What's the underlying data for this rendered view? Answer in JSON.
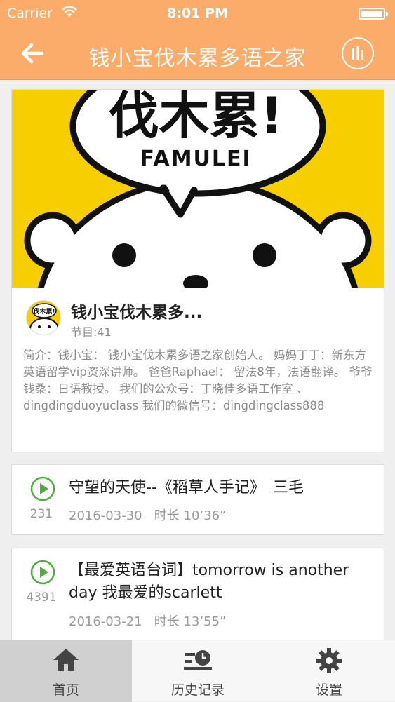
{
  "status_bar": {
    "carrier": "Carrier",
    "time": "8:01 PM"
  },
  "nav": {
    "title": "钱小宝伐木累多语之家"
  },
  "album": {
    "cover_text_cn": "伐木累!",
    "cover_text_en": "FAMULEI",
    "avatar_text": "伐木累!",
    "title": "钱小宝伐木累多...",
    "count": "节目:41",
    "description": "简介：钱小宝： 钱小宝伐木累多语之家创始人。 妈妈丁丁：新东方英语留学vip资深讲师。 爸爸Raphael： 留法8年，法语翻译。 爷爷钱桑：日语教授。 我们的公众号：丁晓佳多语工作室 、dingdingduoyuclass 我们的微信号：dingdingclass888"
  },
  "tracks": [
    {
      "title": "守望的天使--《稻草人手记》　三毛",
      "plays": "231",
      "date": "2016-03-30",
      "duration": "时长 10’36”"
    },
    {
      "title": "【最爱英语台词】tomorrow is another day 我最爱的scarlett",
      "plays": "4391",
      "date": "2016-03-21",
      "duration": "时长 13’55”"
    }
  ],
  "tabs": [
    {
      "label": "首页",
      "icon": "home-icon"
    },
    {
      "label": "历史记录",
      "icon": "history-icon"
    },
    {
      "label": "设置",
      "icon": "gear-icon"
    }
  ],
  "colors": {
    "accent": "#fbac6a",
    "play_green": "#4cae3d",
    "cover_yellow": "#f7cf00"
  }
}
